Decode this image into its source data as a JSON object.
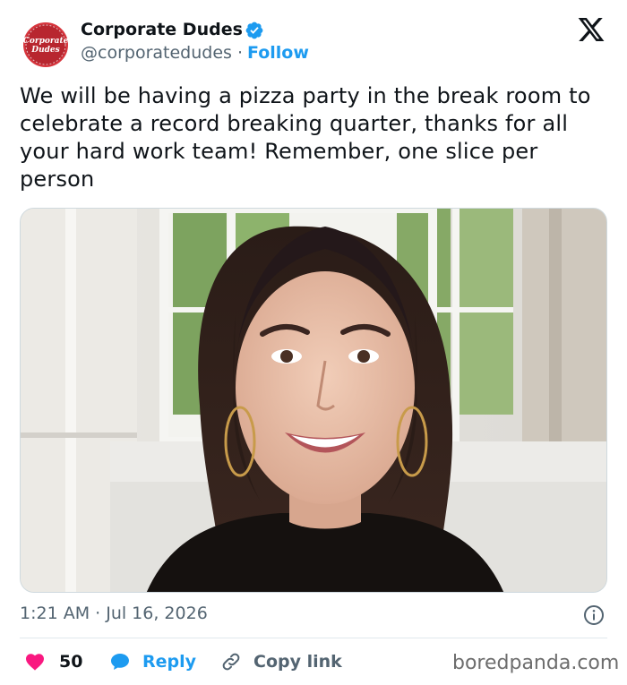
{
  "author": {
    "name": "Corporate Dudes",
    "handle": "@corporatedudes",
    "separator": "·",
    "follow_label": "Follow",
    "avatar_logo_text": "Corporate Dudes",
    "verified_icon": "verified-badge-icon"
  },
  "platform": {
    "logo_icon": "x-logo-icon"
  },
  "tweet": {
    "text": "We will be having a pizza party in the break room to celebrate a record breaking quarter, thanks for all your hard work team! Remember, one slice per person",
    "timestamp": "1:21 AM · Jul 16, 2026"
  },
  "actions": {
    "likes_count": "50",
    "reply_label": "Reply",
    "copy_label": "Copy link"
  },
  "watermark": "boredpanda.com",
  "colors": {
    "brand_blue": "#1d9bf0",
    "like_pink": "#f91880",
    "text_primary": "#0f1419",
    "text_secondary": "#536471",
    "avatar_red": "#b8262f"
  }
}
